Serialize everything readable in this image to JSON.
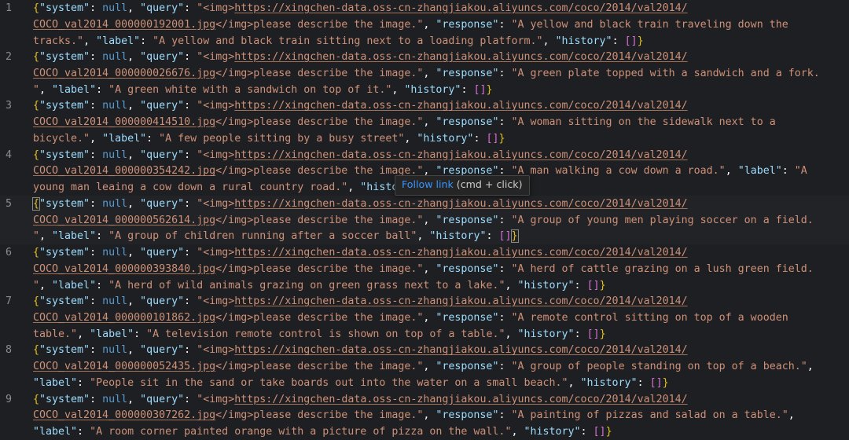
{
  "tooltip": {
    "link_text": "Follow link",
    "hint_text": " (cmd + click)"
  },
  "active_line": 5,
  "lines": [
    {
      "num": "1",
      "url_a": "https://xingchen-data.oss-cn-zhangjiakou.aliyuncs.com/coco/2014/val2014/",
      "url_b": "COCO_val2014_000000192001.jpg",
      "response": "A yellow and black train traveling down the",
      "response_2": "tracks.",
      "label": "A yellow and black train sitting next to a loading platform."
    },
    {
      "num": "2",
      "url_a": "https://xingchen-data.oss-cn-zhangjiakou.aliyuncs.com/coco/2014/val2014/",
      "url_b": "COCO_val2014_000000026676.jpg",
      "response": "A green plate topped with a sandwich and a fork.",
      "response_2": "",
      "label": "A green white with a sandwich on top of it."
    },
    {
      "num": "3",
      "url_a": "https://xingchen-data.oss-cn-zhangjiakou.aliyuncs.com/coco/2014/val2014/",
      "url_b": "COCO_val2014_000000414510.jpg",
      "response": "A woman sitting on the sidewalk next to a",
      "response_2": "bicycle.",
      "label": "A few people sitting by a busy street"
    },
    {
      "num": "4",
      "url_a": "https://xingchen-data.oss-cn-zhangjiakou.aliyuncs.com/coco/2014/val2014/",
      "url_b": "COCO_val2014_000000354242.jpg",
      "response": "A man walking a cow down a road.",
      "response_2": "",
      "label": "A",
      "label_2": "young man leaing a cow down a rural country road."
    },
    {
      "num": "5",
      "url_a": "https://xingchen-data.oss-cn-zhangjiakou.aliyuncs.com/coco/2014/val2014/",
      "url_b": "COCO_val2014_000000562614.jpg",
      "response": "A group of young men playing soccer on a field.",
      "response_2": "",
      "label": "A group of children running after a soccer ball"
    },
    {
      "num": "6",
      "url_a": "https://xingchen-data.oss-cn-zhangjiakou.aliyuncs.com/coco/2014/val2014/",
      "url_b": "COCO_val2014_000000393840.jpg",
      "response": "A herd of cattle grazing on a lush green field.",
      "response_2": "",
      "label": "A herd of wild animals grazing on green grass next to a lake."
    },
    {
      "num": "7",
      "url_a": "https://xingchen-data.oss-cn-zhangjiakou.aliyuncs.com/coco/2014/val2014/",
      "url_b": "COCO_val2014_000000101862.jpg",
      "response": "A remote control sitting on top of a wooden",
      "response_2": "table.",
      "label": "A television remote control is shown on top of a table."
    },
    {
      "num": "8",
      "url_a": "https://xingchen-data.oss-cn-zhangjiakou.aliyuncs.com/coco/2014/val2014/",
      "url_b": "COCO_val2014_000000052435.jpg",
      "response": "A group of people standing on top of a beach.",
      "response_2": "",
      "label": "People sit in the sand or take boards out into the water on a small beach."
    },
    {
      "num": "9",
      "url_a": "https://xingchen-data.oss-cn-zhangjiakou.aliyuncs.com/coco/2014/val2014/",
      "url_b": "COCO_val2014_000000307262.jpg",
      "response": "A painting of pizzas and salad on a table.",
      "response_2": "",
      "label": "A room corner painted orange with a picture of pizza on the wall."
    }
  ],
  "tokens": {
    "system_key": "\"system\"",
    "query_key": "\"query\"",
    "response_key": "\"response\"",
    "label_key": "\"label\"",
    "history_key": "\"history\"",
    "null_value": "null",
    "img_open": "<img>",
    "img_close": "</img>",
    "prompt": "please describe the image."
  }
}
